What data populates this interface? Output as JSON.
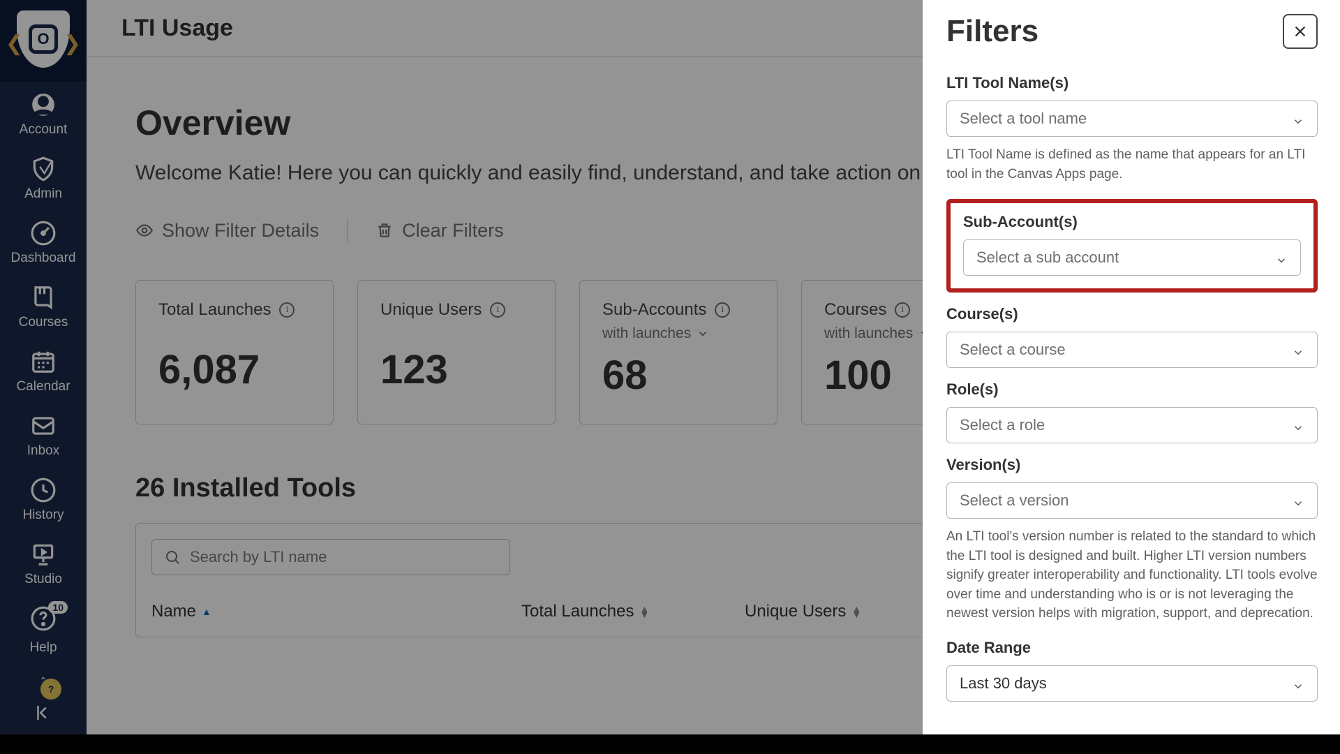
{
  "sidebar": {
    "items": [
      {
        "label": "Account"
      },
      {
        "label": "Admin"
      },
      {
        "label": "Dashboard"
      },
      {
        "label": "Courses"
      },
      {
        "label": "Calendar"
      },
      {
        "label": "Inbox"
      },
      {
        "label": "History"
      },
      {
        "label": "Studio"
      },
      {
        "label": "Help",
        "badge": "10"
      }
    ]
  },
  "topbar": {
    "title": "LTI Usage"
  },
  "overview": {
    "heading": "Overview",
    "welcome": "Welcome Katie! Here you can quickly and easily find, understand, and take action on your LTI tools."
  },
  "filterbar": {
    "show": "Show Filter Details",
    "clear": "Clear Filters"
  },
  "cards": [
    {
      "title": "Total Launches",
      "value": "6,087"
    },
    {
      "title": "Unique Users",
      "value": "123"
    },
    {
      "title": "Sub-Accounts",
      "sub": "with launches",
      "value": "68"
    },
    {
      "title": "Courses",
      "sub": "with launches",
      "value": "100"
    }
  ],
  "tools": {
    "heading": "26 Installed Tools",
    "search_placeholder": "Search by LTI name",
    "columns": {
      "name": "Name",
      "launches": "Total Launches",
      "users": "Unique Users"
    }
  },
  "panel": {
    "title": "Filters",
    "lti_label": "LTI Tool Name(s)",
    "lti_placeholder": "Select a tool name",
    "lti_help": "LTI Tool Name is defined as the name that appears for an LTI tool in the Canvas Apps page.",
    "sub_label": "Sub-Account(s)",
    "sub_placeholder": "Select a sub account",
    "course_label": "Course(s)",
    "course_placeholder": "Select a course",
    "role_label": "Role(s)",
    "role_placeholder": "Select a role",
    "version_label": "Version(s)",
    "version_placeholder": "Select a version",
    "version_help": "An LTI tool's version number is related to the standard to which the LTI tool is designed and built. Higher LTI version numbers signify greater interoperability and functionality. LTI tools evolve over time and understanding who is or is not leveraging the newest version helps with migration, support, and deprecation.",
    "date_label": "Date Range",
    "date_value": "Last 30 days"
  }
}
